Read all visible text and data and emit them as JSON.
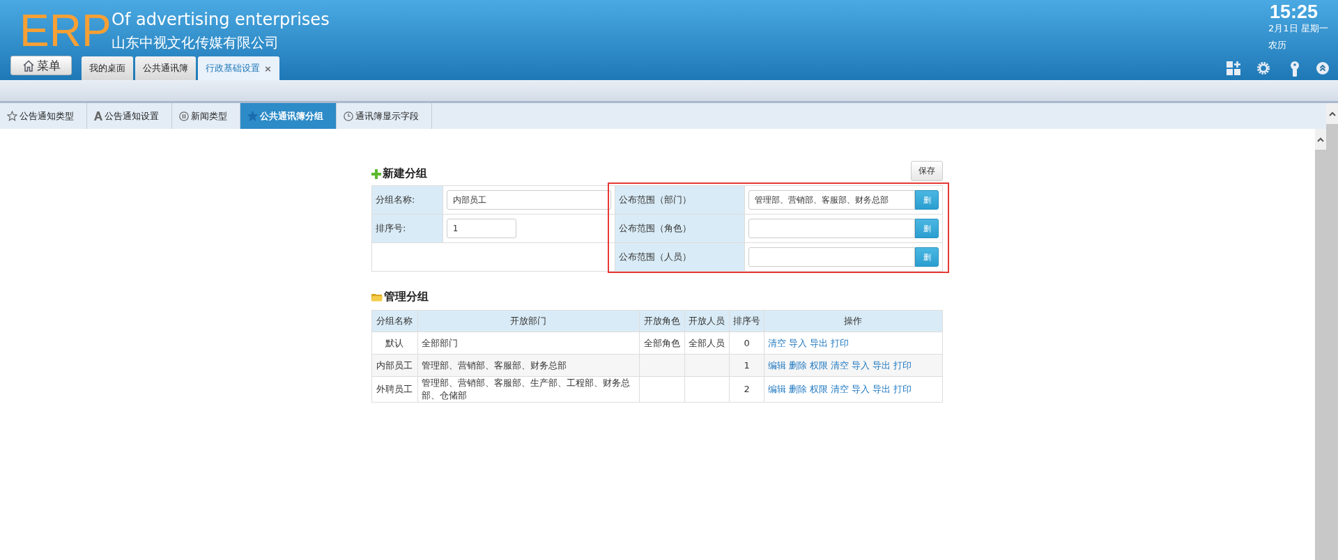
{
  "header": {
    "logo": "ERP",
    "title": "Of advertising enterprises",
    "company": "山东中视文化传媒有限公司",
    "menu_button": "菜单",
    "time": "15:25",
    "date": "2月1日 星期一",
    "lunar": "农历",
    "tabs": [
      {
        "label": "我的桌面",
        "selected": false
      },
      {
        "label": "公共通讯簿",
        "selected": false
      },
      {
        "label": "行政基础设置",
        "selected": true,
        "close": "×"
      }
    ]
  },
  "subtabs": [
    {
      "label": "公告通知类型",
      "kind": "star",
      "selected": false
    },
    {
      "label": "公告通知设置",
      "kind": "letter",
      "selected": false
    },
    {
      "label": "新闻类型",
      "kind": "pause",
      "selected": false
    },
    {
      "label": "公共通讯簿分组",
      "kind": "star",
      "selected": true
    },
    {
      "label": "通讯簿显示字段",
      "kind": "clock",
      "selected": false
    }
  ],
  "new_group": {
    "heading": "新建分组",
    "save_button": "保存",
    "outlined": true,
    "left_fields": [
      {
        "label": "分组名称:",
        "value": "内部员工"
      },
      {
        "label": "排序号:",
        "value": "1"
      }
    ],
    "scope_fields": [
      {
        "label": "公布范围（部门）",
        "value": "管理部、营销部、客服部、财务总部",
        "button": "删"
      },
      {
        "label": "公布范围（角色）",
        "button": "删"
      },
      {
        "label": "公布范围（人员）",
        "button": "删"
      }
    ]
  },
  "manage_groups": {
    "heading": "管理分组",
    "columns": [
      "分组名称",
      "开放部门",
      "开放角色",
      "开放人员",
      "排序号",
      "操作"
    ],
    "rows": [
      {
        "name": "默认",
        "departments": "全部部门",
        "roles": "全部角色",
        "people": "全部人员",
        "order": "0",
        "actions": [
          "清空",
          "导入",
          "导出",
          "打印"
        ]
      },
      {
        "name": "内部员工",
        "departments": "管理部、营销部、客服部、财务总部",
        "order": "1",
        "actions": [
          "编辑",
          "删除",
          "权限",
          "清空",
          "导入",
          "导出",
          "打印"
        ]
      },
      {
        "name": "外聘员工",
        "departments": "管理部、营销部、客服部、生产部、工程部、财务总部、仓储部",
        "order": "2",
        "actions": [
          "编辑",
          "删除",
          "权限",
          "清空",
          "导入",
          "导出",
          "打印"
        ]
      }
    ]
  }
}
